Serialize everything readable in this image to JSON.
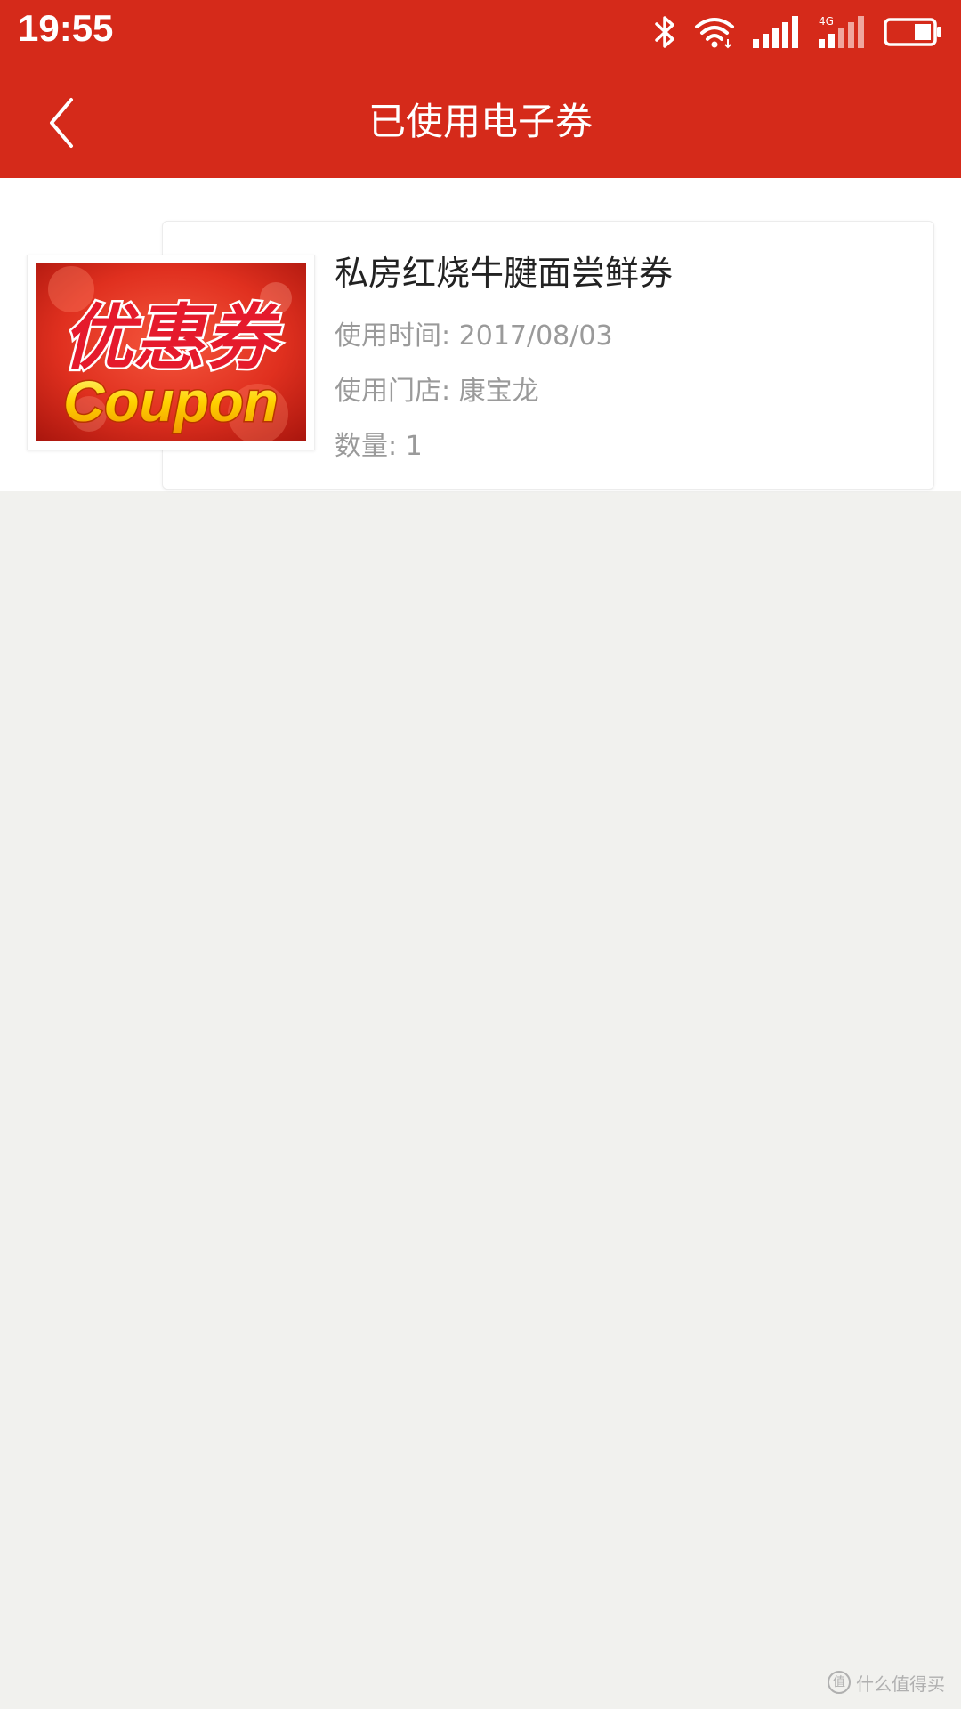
{
  "status_bar": {
    "time": "19:55",
    "icons": [
      "bluetooth-icon",
      "wifi-icon",
      "signal-icon",
      "signal-4g-icon",
      "battery-icon"
    ],
    "network_label": "4G"
  },
  "header": {
    "back_icon": "chevron-left-icon",
    "title": "已使用电子券",
    "background_color": "#d52a1a"
  },
  "coupons": [
    {
      "image_text_cn": "优惠券",
      "image_text_en": "Coupon",
      "name": "私房红烧牛腱面尝鲜券",
      "used_time": "使用时间: 2017/08/03",
      "store": "使用门店: 康宝龙",
      "quantity": "数量: 1"
    }
  ],
  "watermark": {
    "text": "什么值得买",
    "icon": "值"
  },
  "colors": {
    "accent": "#d52a1a",
    "page_bg": "#f1f1ee",
    "secondary_text": "#9a9a9a"
  }
}
